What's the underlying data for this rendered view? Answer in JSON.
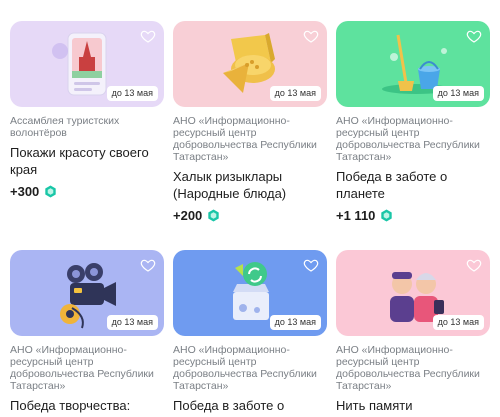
{
  "cards": [
    {
      "org": "Ассамблея туристских волонтёров",
      "title": "Покажи красоту своего края",
      "points": "+300",
      "date": "до 13 мая",
      "bg": "#e6d9f7",
      "icon": "phone-with-kremlin-photo-icon"
    },
    {
      "org": "АНО «Информационно-ресурсный центр добровольчества Республики Татарстан»",
      "title": "Халык ризыклары (Народные блюда)",
      "points": "+200",
      "date": "до 13 мая",
      "bg": "#f8cfd6",
      "icon": "chak-chak-pastry-icon"
    },
    {
      "org": "АНО «Информационно-ресурсный центр добровольчества Республики Татарстан»",
      "title": "Победа в заботе о планете",
      "points": "+1 110",
      "date": "до 13 мая",
      "bg": "#5ee29e",
      "icon": "cleaning-bucket-broom-icon"
    },
    {
      "org": "АНО «Информационно-ресурсный центр добровольчества Республики Татарстан»",
      "title": "Победа творчества: добрый",
      "points": "",
      "date": "до 13 мая",
      "bg": "#aab5f3",
      "icon": "film-camera-icon"
    },
    {
      "org": "АНО «Информационно-ресурсный центр добровольчества Республики Татарстан»",
      "title": "Победа в заботе о планете",
      "points": "",
      "date": "до 13 мая",
      "bg": "#6f9bf0",
      "icon": "recycling-box-icon"
    },
    {
      "org": "АНО «Информационно-ресурсный центр добровольчества Республики Татарстан»",
      "title": "Нить памяти",
      "points": "",
      "date": "до 13 мая",
      "bg": "#fbc8d6",
      "icon": "veterans-couple-icon"
    }
  ],
  "colors": {
    "coin": "#19c6a7",
    "heart": "#ffffff"
  }
}
